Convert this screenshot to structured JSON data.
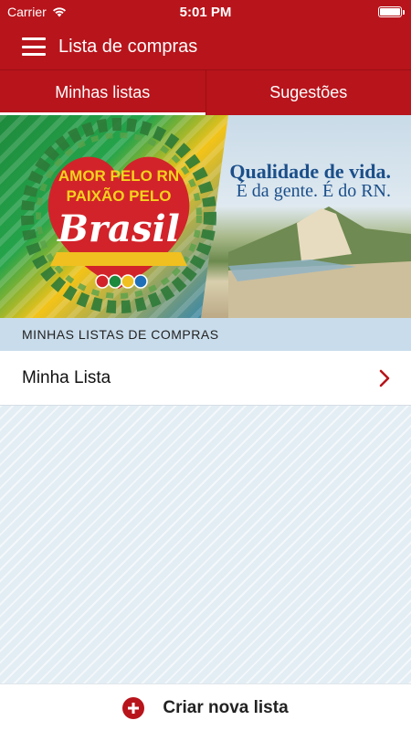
{
  "status_bar": {
    "carrier": "Carrier",
    "time": "5:01 PM"
  },
  "app_bar": {
    "title": "Lista de compras",
    "menu_icon": "hamburger-menu-icon"
  },
  "tabs": [
    {
      "label": "Minhas listas",
      "active": true
    },
    {
      "label": "Sugestões",
      "active": false
    }
  ],
  "banner": {
    "badge_line1": "AMOR PELO RN",
    "badge_line2": "PAIXÃO PELO",
    "badge_line3": "Brasil",
    "tagline_line1": "Qualidade de vida.",
    "tagline_line2": "É da gente. É do RN."
  },
  "section": {
    "header": "MINHAS LISTAS DE COMPRAS",
    "items": [
      {
        "label": "Minha Lista"
      }
    ]
  },
  "bottom_bar": {
    "label": "Criar nova lista",
    "icon": "plus-circle-icon"
  },
  "colors": {
    "brand_red": "#b8141b",
    "section_bg": "#c9dceb"
  }
}
